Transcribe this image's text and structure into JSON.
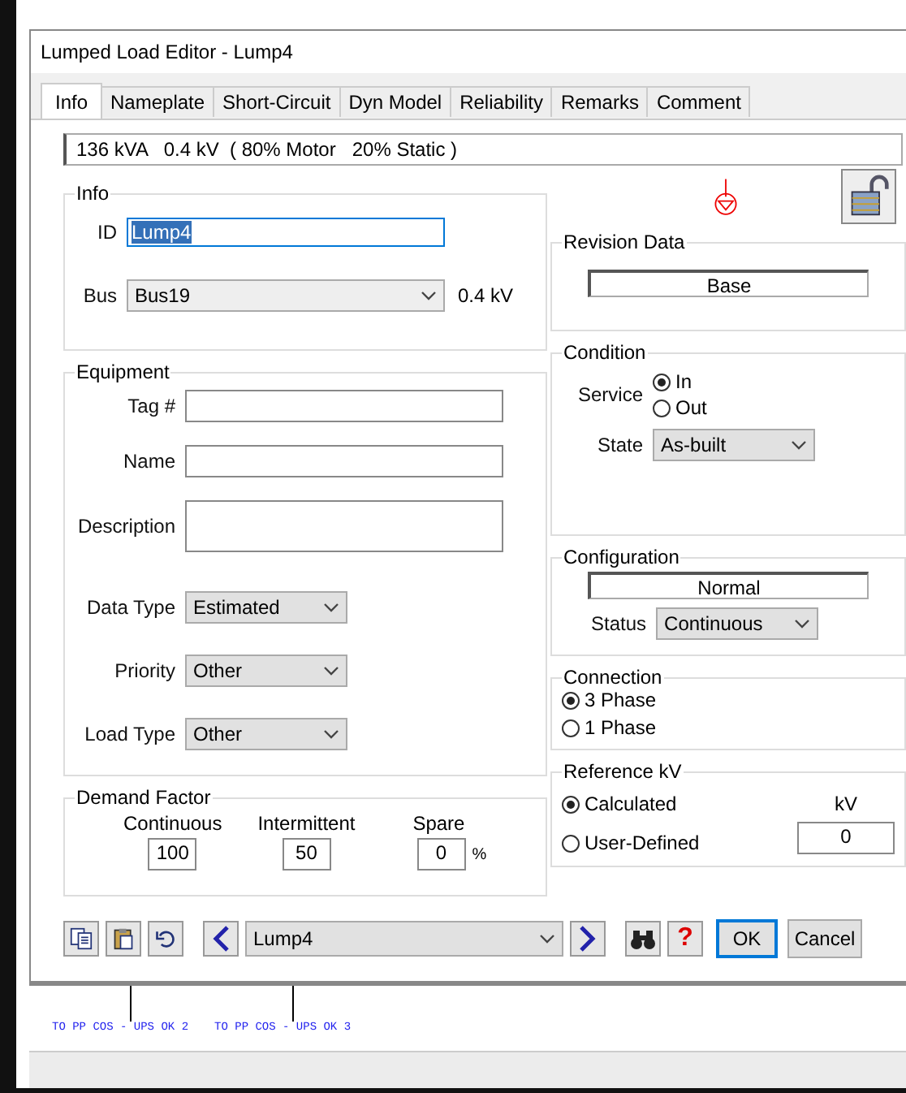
{
  "window": {
    "title": "Lumped Load Editor - Lump4"
  },
  "tabs": [
    {
      "label": "Info",
      "selected": true
    },
    {
      "label": "Nameplate",
      "selected": false
    },
    {
      "label": "Short-Circuit",
      "selected": false
    },
    {
      "label": "Dyn Model",
      "selected": false
    },
    {
      "label": "Reliability",
      "selected": false
    },
    {
      "label": "Remarks",
      "selected": false
    },
    {
      "label": "Comment",
      "selected": false
    }
  ],
  "summary": "136 kVA   0.4 kV  ( 80% Motor   20% Static )",
  "info": {
    "title": "Info",
    "id_label": "ID",
    "id": "Lump4",
    "id_highlighted": true,
    "bus_label": "Bus",
    "bus": "Bus19",
    "bus_kv": "0.4 kV"
  },
  "revision_data": {
    "title": "Revision Data",
    "value": "Base"
  },
  "equipment": {
    "title": "Equipment",
    "fields": [
      {
        "label": "Tag #",
        "kind": "text"
      },
      {
        "label": "Name",
        "kind": "text"
      },
      {
        "label": "Description",
        "kind": "textarea"
      },
      {
        "label": "Data Type",
        "kind": "select",
        "value": "Estimated"
      },
      {
        "label": "Priority",
        "kind": "select",
        "value": "Other"
      },
      {
        "label": "Load Type",
        "kind": "select",
        "value": "Other"
      }
    ]
  },
  "condition": {
    "title": "Condition",
    "service_label": "Service",
    "options": [
      {
        "label": "In",
        "selected": true
      },
      {
        "label": "Out",
        "selected": false
      }
    ],
    "state_label": "State",
    "state": "As-built"
  },
  "configuration": {
    "title": "Configuration",
    "value": "Normal",
    "status_label": "Status",
    "status": "Continuous"
  },
  "connection": {
    "title": "Connection",
    "options": [
      {
        "label": "3 Phase",
        "selected": true
      },
      {
        "label": "1 Phase",
        "selected": false
      }
    ]
  },
  "demand_factor": {
    "title": "Demand Factor",
    "fields": [
      {
        "label": "Continuous",
        "value": "100"
      },
      {
        "label": "Intermittent",
        "value": "50"
      },
      {
        "label": "Spare",
        "value": "0"
      }
    ],
    "unit": "%"
  },
  "reference_kv": {
    "title": "Reference kV",
    "options": [
      {
        "label": "Calculated",
        "selected": true
      },
      {
        "label": "User-Defined",
        "selected": false
      }
    ],
    "kv_label": "kV",
    "kv_value": "0"
  },
  "navigator": {
    "value": "Lump4"
  },
  "help_symbol": "?",
  "buttons": [
    {
      "label": "OK",
      "default": true
    },
    {
      "label": "Cancel",
      "default": false
    }
  ],
  "schematic": {
    "labels": [
      "TO PP COS - UPS OK 2",
      "TO PP COS - UPS OK 3"
    ]
  }
}
